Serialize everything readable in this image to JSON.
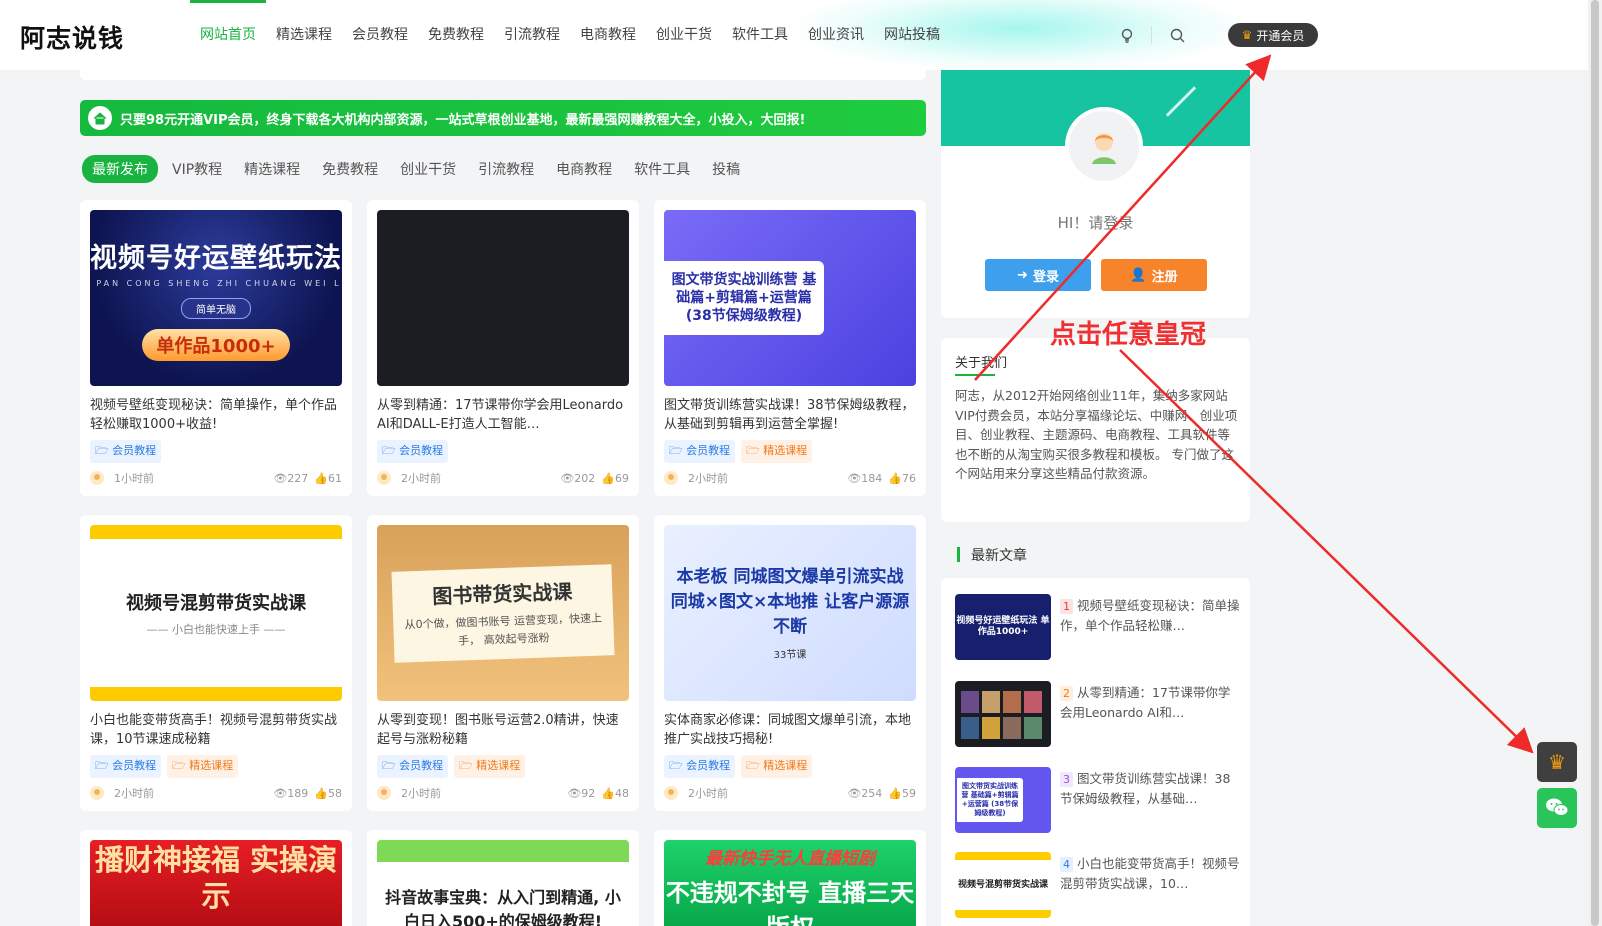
{
  "header": {
    "logo": "阿志说钱",
    "nav": [
      "网站首页",
      "精选课程",
      "会员教程",
      "免费教程",
      "引流教程",
      "电商教程",
      "创业干货",
      "软件工具",
      "创业资讯",
      "网站投稿"
    ],
    "vip_button": "开通会员"
  },
  "announcement": "只要98元开通VIP会员，终身下载各大机构内部资源，一站式草根创业基地，最新最强网赚教程大全，小投入，大回报!",
  "tabs": [
    "最新发布",
    "VIP教程",
    "精选课程",
    "免费教程",
    "创业干货",
    "引流教程",
    "电商教程",
    "软件工具",
    "投稿"
  ],
  "cards": [
    {
      "thumb_big": "视频号好运壁纸玩法",
      "thumb_small": "NI PAN CONG SHENG ZHI CHUANG WEI LAI",
      "thumb_chip": "简单无脑",
      "thumb_pill": "单作品1000+",
      "title": "视频号壁纸变现秘诀：简单操作，单个作品轻松赚取1000+收益!",
      "badges": [
        "会员教程"
      ],
      "time": "1小时前",
      "views": "227",
      "likes": "61"
    },
    {
      "title": "从零到精通：17节课带你学会用Leonardo AI和DALL-E打造人工智能…",
      "badges": [
        "会员教程"
      ],
      "time": "2小时前",
      "views": "202",
      "likes": "69"
    },
    {
      "thumb_big": "图文带货实战训练营 基础篇+剪辑篇+运营篇 (38节保姆级教程)",
      "title": "图文带货训练营实战课！38节保姆级教程，从基础到剪辑再到运营全掌握!",
      "badges": [
        "会员教程",
        "精选课程"
      ],
      "time": "2小时前",
      "views": "184",
      "likes": "76"
    },
    {
      "thumb_big": "视频号混剪带货实战课",
      "thumb_small": "—— 小白也能快速上手 ——",
      "title": "小白也能变带货高手！视频号混剪带货实战课，10节课速成秘籍",
      "badges": [
        "会员教程",
        "精选课程"
      ],
      "time": "2小时前",
      "views": "189",
      "likes": "58"
    },
    {
      "thumb_big": "图书带货实战课",
      "thumb_small": "从0个做，做图书账号 运营变现，快速上手， 高效起号涨粉",
      "title": "从零到变现！图书账号运营2.0精讲，快速起号与涨粉秘籍",
      "badges": [
        "会员教程",
        "精选课程"
      ],
      "time": "2小时前",
      "views": "92",
      "likes": "48"
    },
    {
      "thumb_big": "本老板 同城图文爆单引流实战 同城×图文×本地推 让客户源源不断",
      "thumb_small": "33节课",
      "title": "实体商家必修课：同城图文爆单引流，本地推广实战技巧揭秘!",
      "badges": [
        "会员教程",
        "精选课程"
      ],
      "time": "2小时前",
      "views": "254",
      "likes": "59"
    },
    {
      "thumb_big": "播财神接福 实操演示"
    },
    {
      "thumb_big": "抖音故事宝典：从入门到精通, 小白日入500+的保姆级教程!"
    },
    {
      "thumb_top": "最新快手无人直播短剧",
      "thumb_big": "不违规不封号 直播三天版权"
    }
  ],
  "sidebar": {
    "greeting": "HI！请登录",
    "login": "登录",
    "register": "注册",
    "about_title": "关于我们",
    "about_text": "阿志，从2012开始网络创业11年，集纳多家网站VIP付费会员，本站分享福缘论坛、中赚网、创业项目、创业教程、主题源码、电商教程、工具软件等也不断的从淘宝购买很多教程和模板。 专门做了这个网站用来分享这些精品付款资源。",
    "latest_title": "最新文章",
    "latest": [
      {
        "rank": "1",
        "text": "视频号壁纸变现秘诀：简单操作，单个作品轻松赚…",
        "thumb": "视频号好运壁纸玩法 单作品1000+"
      },
      {
        "rank": "2",
        "text": "从零到精通：17节课带你学会用Leonardo AI和…",
        "thumb": ""
      },
      {
        "rank": "3",
        "text": "图文带货训练营实战课！38节保姆级教程，从基础…",
        "thumb": "图文带货实战训练营 基础篇+剪辑篇+运营篇 (38节保姆级教程)"
      },
      {
        "rank": "4",
        "text": "小白也能变带货高手！视频号混剪带货实战课，10…",
        "thumb": "视频号混剪带货实战课"
      }
    ]
  },
  "annotation": "点击任意皇冠",
  "colors": {
    "green": "#18b340",
    "accent_red": "#f03030",
    "vip_dark": "#3a3a3a"
  }
}
